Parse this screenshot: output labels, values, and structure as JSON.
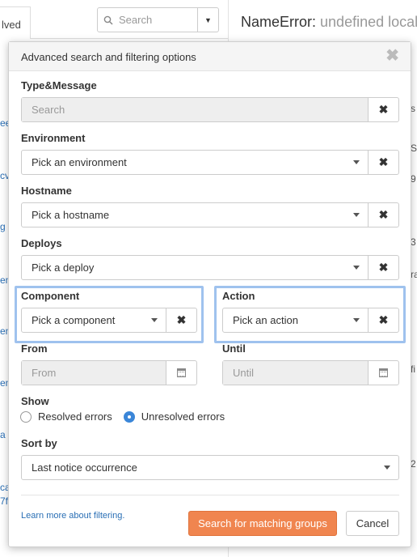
{
  "background": {
    "tab_label": "lved",
    "search_placeholder": "Search",
    "title": "NameError:",
    "title_muted": "undefined local",
    "left_fragments": [
      "ee",
      "cv",
      "g",
      "en",
      "en",
      "en",
      "a h",
      "cal",
      "7f"
    ],
    "right_fragments": [
      "s",
      "S:",
      "9",
      "3",
      "ra",
      "fi",
      "2"
    ]
  },
  "modal": {
    "title": "Advanced search and filtering options",
    "close_icon": "close-icon",
    "type_message": {
      "label": "Type&Message",
      "placeholder": "Search"
    },
    "environment": {
      "label": "Environment",
      "value": "Pick an environment"
    },
    "hostname": {
      "label": "Hostname",
      "value": "Pick a hostname"
    },
    "deploys": {
      "label": "Deploys",
      "value": "Pick a deploy"
    },
    "component": {
      "label": "Component",
      "value": "Pick a component"
    },
    "action": {
      "label": "Action",
      "value": "Pick an action"
    },
    "from": {
      "label": "From",
      "placeholder": "From"
    },
    "until": {
      "label": "Until",
      "placeholder": "Until"
    },
    "show": {
      "label": "Show",
      "options": [
        {
          "label": "Resolved errors",
          "selected": false
        },
        {
          "label": "Unresolved errors",
          "selected": true
        }
      ]
    },
    "sort_by": {
      "label": "Sort by",
      "value": "Last notice occurrence"
    },
    "learn_more": "Learn more about filtering.",
    "submit_label": "Search for matching groups",
    "cancel_label": "Cancel"
  },
  "colors": {
    "primary_button": "#f0854f",
    "highlight_border": "#9fc2ee",
    "link": "#2a6fb5",
    "radio_selected": "#3b86d8"
  }
}
